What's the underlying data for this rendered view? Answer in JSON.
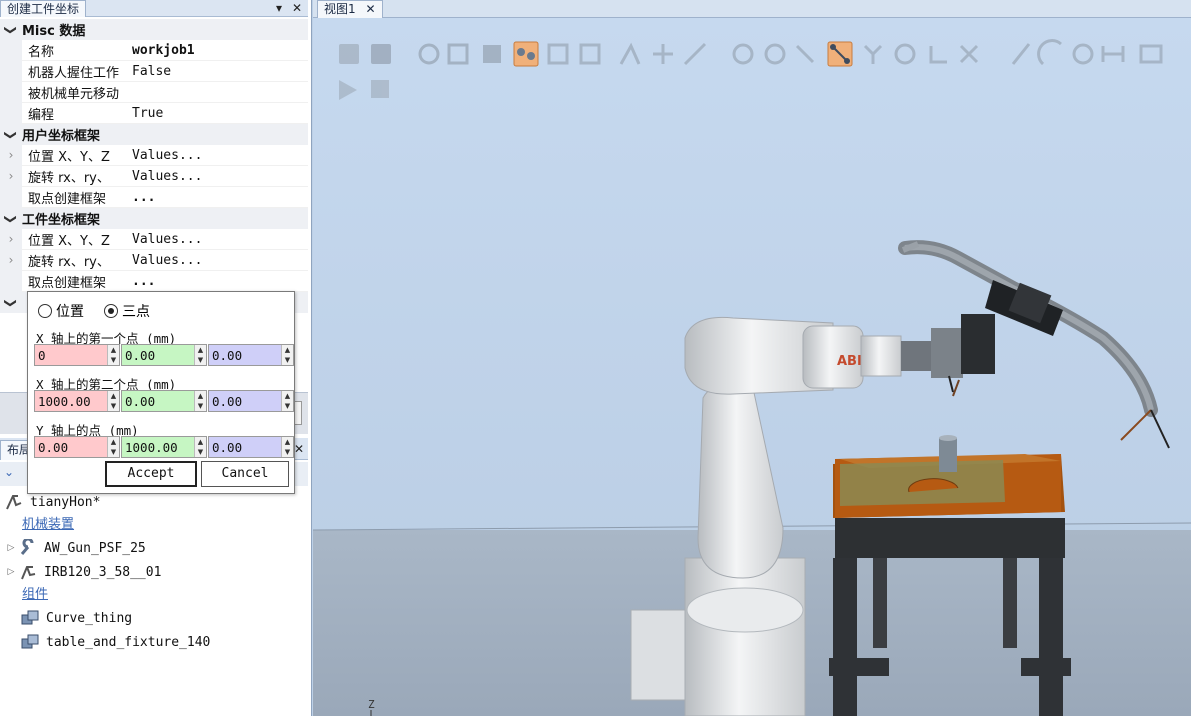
{
  "panel": {
    "title": "创建工件坐标",
    "pin": "▾",
    "close": "✕"
  },
  "props": {
    "misc": {
      "header": "Misc 数据",
      "name_label": "名称",
      "name_value": "workjob1",
      "held_label": "机器人握住工作",
      "held_value": "False",
      "moved_label": "被机械单元移动",
      "moved_value": "",
      "prog_label": "编程",
      "prog_value": "True"
    },
    "user_frame": {
      "header": "用户坐标框架",
      "pos_label": "位置 X、Y、Z",
      "pos_value": "Values...",
      "rot_label": "旋转 rx、ry、",
      "rot_value": "Values...",
      "pick_label": "取点创建框架",
      "pick_value": "..."
    },
    "obj_frame": {
      "header": "工件坐标框架",
      "pos_label": "位置 X、Y、Z",
      "pos_value": "Values...",
      "rot_label": "旋转 rx、ry、",
      "rot_value": "Values...",
      "pick_label": "取点创建框架",
      "pick_value": "..."
    }
  },
  "popup": {
    "radio_position": "位置",
    "radio_three_point": "三点",
    "selected": "three_point",
    "x1_label": "X 轴上的第一个点 (mm)",
    "x1": [
      "0",
      "0.00",
      "0.00"
    ],
    "x2_label": "X 轴上的第二个点 (mm)",
    "x2": [
      "1000.00",
      "0.00",
      "0.00"
    ],
    "y_label": "Y 轴上的点 (mm)",
    "y": [
      "0.00",
      "1000.00",
      "0.00"
    ],
    "accept": "Accept",
    "cancel": "Cancel"
  },
  "layout": {
    "tab": "布局",
    "station": "tianyHon*",
    "group_mech": "机械装置",
    "mech_items": [
      "AW_Gun_PSF_25",
      "IRB120_3_58__01"
    ],
    "group_comp": "组件",
    "comp_items": [
      "Curve_thing",
      "table_and_fixture_140"
    ]
  },
  "view": {
    "tab": "视图1",
    "close": "✕",
    "axis_label": "Z",
    "robot_logo": "ABB"
  },
  "colors": {
    "x_field": "#ffc9cc",
    "y_field": "#c6f6c3",
    "z_field": "#cfcff8",
    "background": "#c2d6ee",
    "table_top": "#b65a12",
    "tool_highlight": "#f0b07a"
  }
}
